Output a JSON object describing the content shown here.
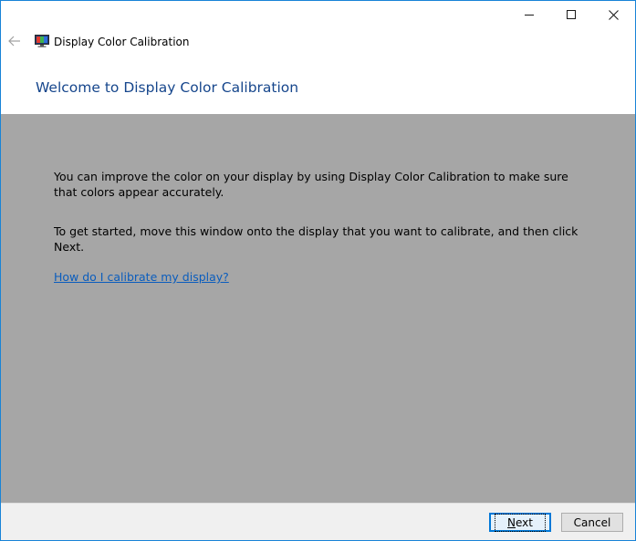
{
  "window": {
    "title": "Display Color Calibration"
  },
  "caption_buttons": {
    "minimize_icon": "minimize-icon",
    "maximize_icon": "maximize-icon",
    "close_icon": "close-icon"
  },
  "nav": {
    "back_icon": "back-arrow-icon",
    "app_icon": "display-calibration-icon"
  },
  "page": {
    "heading": "Welcome to Display Color Calibration",
    "paragraph1": "You can improve the color on your display by using Display Color Calibration to make sure that colors appear accurately.",
    "paragraph2": "To get started, move this window onto the display that you want to calibrate, and then click Next.",
    "help_link": "How do I calibrate my display?"
  },
  "footer": {
    "next_label_mnemonic": "N",
    "next_label_rest": "ext",
    "cancel_label": "Cancel"
  },
  "colors": {
    "content_bg": "#a6a6a6",
    "heading": "#16468c",
    "link": "#0b5dbd",
    "accent": "#0078d7"
  }
}
